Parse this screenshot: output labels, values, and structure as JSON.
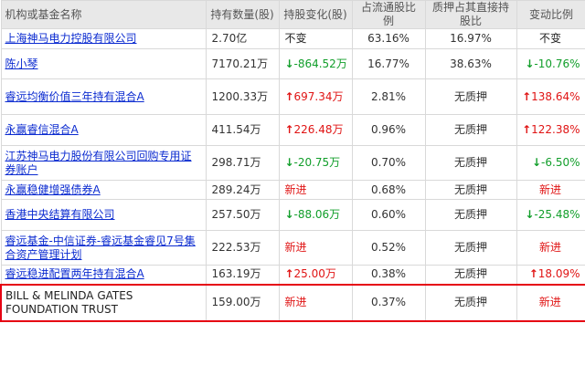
{
  "columns": [
    "机构或基金名称",
    "持有数量(股)",
    "持股变化(股)",
    "占流通股比例",
    "质押占其直接持股比",
    "变动比例"
  ],
  "rows": [
    {
      "name": "上海神马电力控股有限公司",
      "link": true,
      "shares": "2.70亿",
      "change": "不变",
      "change_dir": "neutral",
      "float_pct": "63.16%",
      "pledge": "16.97%",
      "change_pct": "不变",
      "pct_dir": "neutral"
    },
    {
      "name": "陈小琴",
      "link": true,
      "shares": "7170.21万",
      "change": "-864.52万",
      "change_dir": "down",
      "float_pct": "16.77%",
      "pledge": "38.63%",
      "change_pct": "-10.76%",
      "pct_dir": "down"
    },
    {
      "name": "睿远均衡价值三年持有混合A",
      "link": true,
      "shares": "1200.33万",
      "change": "697.34万",
      "change_dir": "up",
      "float_pct": "2.81%",
      "pledge": "无质押",
      "change_pct": "138.64%",
      "pct_dir": "up"
    },
    {
      "name": "永赢睿信混合A",
      "link": true,
      "shares": "411.54万",
      "change": "226.48万",
      "change_dir": "up",
      "float_pct": "0.96%",
      "pledge": "无质押",
      "change_pct": "122.38%",
      "pct_dir": "up"
    },
    {
      "name": "江苏神马电力股份有限公司回购专用证券账户",
      "link": true,
      "shares": "298.71万",
      "change": "-20.75万",
      "change_dir": "down",
      "float_pct": "0.70%",
      "pledge": "无质押",
      "change_pct": "-6.50%",
      "pct_dir": "down"
    },
    {
      "name": "永赢稳健增强债券A",
      "link": true,
      "shares": "289.24万",
      "change": "新进",
      "change_dir": "new",
      "float_pct": "0.68%",
      "pledge": "无质押",
      "change_pct": "新进",
      "pct_dir": "new"
    },
    {
      "name": "香港中央结算有限公司",
      "link": true,
      "shares": "257.50万",
      "change": "-88.06万",
      "change_dir": "down",
      "float_pct": "0.60%",
      "pledge": "无质押",
      "change_pct": "-25.48%",
      "pct_dir": "down"
    },
    {
      "name": "睿远基金-中信证券-睿远基金睿见7号集合资产管理计划",
      "link": true,
      "shares": "222.53万",
      "change": "新进",
      "change_dir": "new",
      "float_pct": "0.52%",
      "pledge": "无质押",
      "change_pct": "新进",
      "pct_dir": "new"
    },
    {
      "name": "睿远稳进配置两年持有混合A",
      "link": true,
      "shares": "163.19万",
      "change": "25.00万",
      "change_dir": "up",
      "float_pct": "0.38%",
      "pledge": "无质押",
      "change_pct": "18.09%",
      "pct_dir": "up"
    },
    {
      "name": "BILL & MELINDA GATES FOUNDATION TRUST",
      "link": false,
      "highlight": true,
      "shares": "159.00万",
      "change": "新进",
      "change_dir": "new",
      "float_pct": "0.37%",
      "pledge": "无质押",
      "change_pct": "新进",
      "pct_dir": "new"
    }
  ],
  "colors": {
    "up": "#e01414",
    "down": "#119e2a",
    "link": "#0b2bd0",
    "highlight_border": "#e60012",
    "header_bg": "#e8e8e8"
  }
}
